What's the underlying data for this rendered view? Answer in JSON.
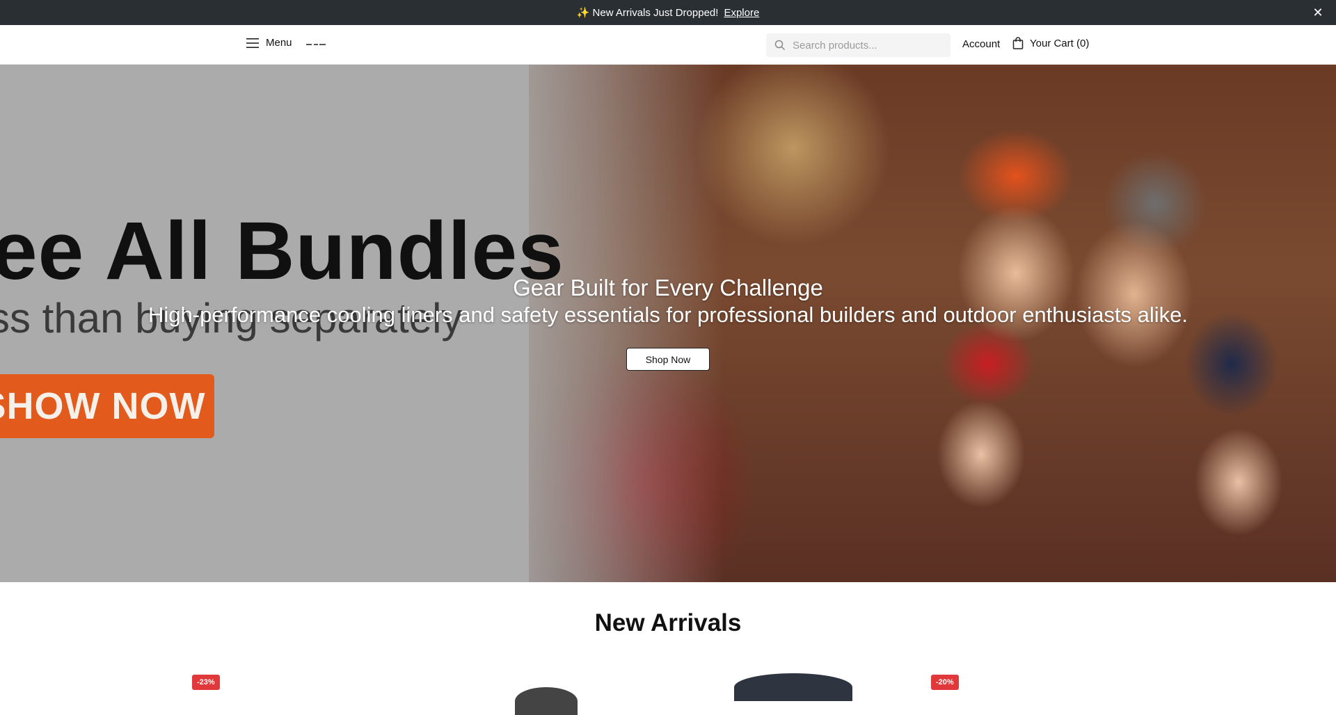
{
  "announcement": {
    "text": "✨ New Arrivals Just Dropped!",
    "link": "Explore",
    "close_icon": "close-icon"
  },
  "header": {
    "menu_label": "Menu",
    "search_placeholder": "Search products...",
    "account_label": "Account",
    "cart_label": "Your Cart (0)"
  },
  "hero": {
    "banner_title": "ee All Bundles",
    "banner_subtitle": "ss than buying separately",
    "banner_button": "SHOW NOW",
    "headline": "Gear Built for Every Challenge",
    "subheadline": "High-performance cooling liners and safety essentials for professional builders and outdoor enthusiasts alike.",
    "cta": "Shop Now"
  },
  "new_arrivals": {
    "title": "New Arrivals",
    "badges": [
      "-23%",
      "-20%"
    ]
  },
  "colors": {
    "announcement_bg": "#2a2f33",
    "badge": "#e0383b",
    "banner_button": "#e25a1c"
  }
}
